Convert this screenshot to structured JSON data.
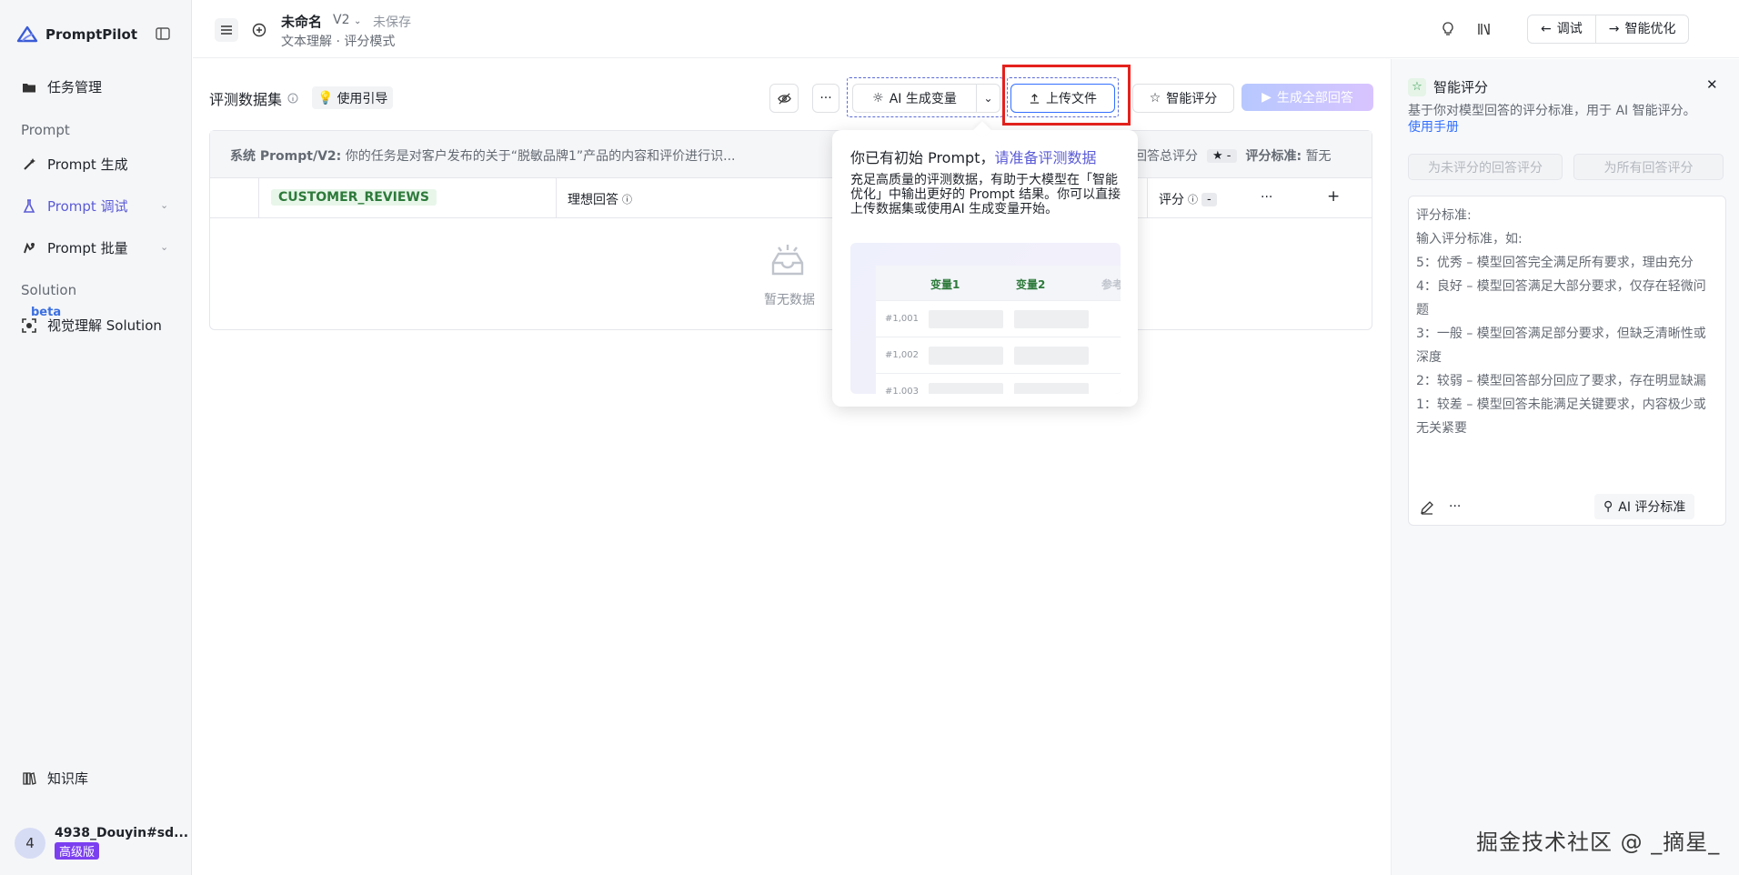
{
  "sidebar": {
    "logo": "PromptPilot",
    "items": [
      {
        "label": "任务管理"
      },
      {
        "label": "Prompt 生成"
      },
      {
        "label": "Prompt 调试"
      },
      {
        "label": "Prompt 批量"
      },
      {
        "label": "视觉理解 Solution"
      },
      {
        "label": "知识库"
      }
    ],
    "section_prompt": "Prompt",
    "section_solution": "Solution",
    "beta": "beta",
    "user": {
      "avatar": "4",
      "name": "4938_Douyin#sd...",
      "tier": "高级版"
    }
  },
  "topbar": {
    "title": "未命名",
    "version": "V2",
    "saved": "未保存",
    "mode": "文本理解 · 评分模式",
    "debug": "调试",
    "optimize": "智能优化"
  },
  "main": {
    "section_title": "评测数据集",
    "guide": "使用引导",
    "more": "···",
    "ai_gen": "AI 生成变量",
    "upload": "上传文件",
    "smart_score": "智能评分",
    "gen_all": "生成全部回答",
    "system_label": "系统 Prompt/V2:",
    "system_text": "你的任务是对客户发布的关于“脱敏品牌1”产品的内容和评价进行识...",
    "total_score": "回答总评分",
    "star_value": "-",
    "criteria_label": "评分标准:",
    "criteria_value": "暂无",
    "col_var": "CUSTOMER_REVIEWS",
    "col_ideal": "理想回答",
    "col_score": "评分",
    "score_tag": "-",
    "col_more": "···",
    "col_add": "+",
    "empty": "暂无数据"
  },
  "popover": {
    "title_a": "你已有初始 Prompt，",
    "title_link": "请准备评测数据",
    "desc": "充足高质量的评测数据，有助于大模型在「智能优化」中输出更好的 Prompt 结果。你可以直接上传数据集或使用AI 生成变量开始。",
    "preview": {
      "headers": [
        "变量1",
        "变量2",
        "参考"
      ],
      "rows": [
        "#1,001",
        "#1,002",
        "#1,003"
      ]
    }
  },
  "right_panel": {
    "title": "智能评分",
    "desc": "基于你对模型回答的评分标准，用于 AI 智能评分。",
    "manual": "使用手册",
    "btn_unscored": "为未评分的回答评分",
    "btn_all": "为所有回答评分",
    "criteria": [
      "评分标准:",
      "输入评分标准，如:",
      "5：优秀 – 模型回答完全满足所有要求，理由充分",
      "4：良好 – 模型回答满足大部分要求，仅存在轻微问题",
      "3：一般 – 模型回答满足部分要求，但缺乏清晰性或深度",
      "2：较弱 – 模型回答部分回应了要求，存在明显缺漏",
      "1：较差 – 模型回答未能满足关键要求，内容极少或无关紧要"
    ],
    "more": "···",
    "ai_criteria": "AI 评分标准"
  },
  "watermark": "掘金技术社区 @ _摘星_",
  "colors": {
    "accent": "#5b5bd6",
    "highlight": "#e5211d",
    "tier": "#7b3ff0"
  }
}
